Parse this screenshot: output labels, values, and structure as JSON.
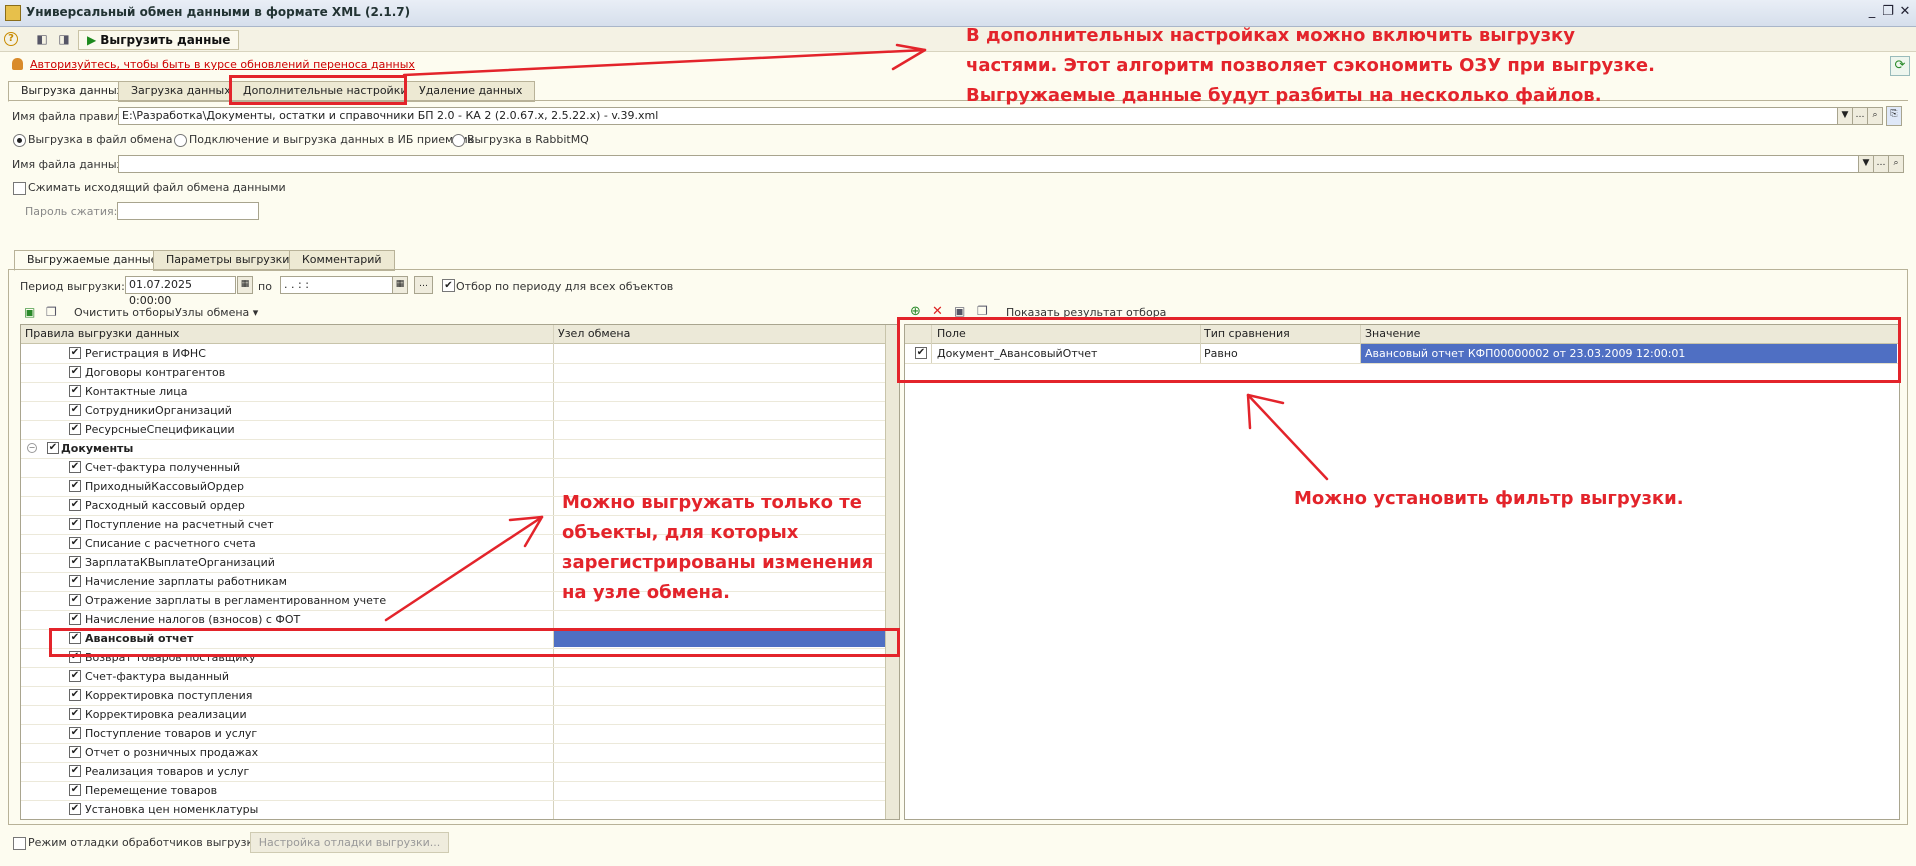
{
  "window": {
    "title": "Универсальный обмен данными в формате XML (2.1.7)"
  },
  "toolbar": {
    "export_label": "Выгрузить данные"
  },
  "auth_link": "Авторизуйтесь, чтобы быть в курсе обновлений переноса данных",
  "main_tabs": [
    "Выгрузка данных",
    "Загрузка данных",
    "Дополнительные настройки",
    "Удаление данных"
  ],
  "rules_file": {
    "label": "Имя файла правил:",
    "value": "E:\\Разработка\\Документы, остатки и справочники БП 2.0 - КА 2 (2.0.67.x, 2.5.22.x) - v.39.xml"
  },
  "export_modes": [
    "Выгрузка в файл обмена",
    "Подключение и выгрузка данных в ИБ приемник",
    "Выгрузка в RabbitMQ"
  ],
  "data_file": {
    "label": "Имя файла данных:",
    "value": ""
  },
  "compress": {
    "label": "Сжимать исходящий файл обмена данными"
  },
  "password": {
    "label": "Пароль сжатия:",
    "value": ""
  },
  "sub_tabs": [
    "Выгружаемые данные",
    "Параметры выгрузки",
    "Комментарий"
  ],
  "period": {
    "label": "Период выгрузки:",
    "from": "01.07.2025  0:00:00",
    "to_label": "по",
    "to": " .  .       :  :",
    "filter_all": "Отбор по периоду для всех объектов"
  },
  "rules_toolbar": {
    "clear": "Очистить отборы",
    "nodes": "Узлы обмена"
  },
  "rules_grid": {
    "headers": [
      "Правила выгрузки данных",
      "Узел обмена"
    ],
    "group_label": "Документы",
    "rows_top": [
      "Регистрация в ИФНС",
      "Договоры контрагентов",
      "Контактные лица",
      "СотрудникиОрганизаций",
      "РесурсныеСпецификации"
    ],
    "rows_docs": [
      "Счет-фактура полученный",
      "ПриходныйКассовыйОрдер",
      "Расходный кассовый ордер",
      "Поступление на расчетный счет",
      "Списание с расчетного счета",
      "ЗарплатаКВыплатеОрганизаций",
      "Начисление зарплаты работникам",
      "Отражение зарплаты в регламентированном учете",
      "Начисление налогов (взносов) с ФОТ"
    ],
    "selected_row": "Авансовый отчет",
    "rows_after": [
      "Возврат товаров поставщику",
      "Счет-фактура выданный",
      "Корректировка поступления",
      "Корректировка реализации",
      "Поступление товаров и услуг",
      "Отчет о розничных продажах",
      "Реализация товаров и услуг",
      "Перемещение товаров",
      "Установка цен номенклатуры"
    ]
  },
  "filter_toolbar": {
    "show_result": "Показать результат отбора"
  },
  "filter_grid": {
    "headers": [
      "Поле",
      "Тип сравнения",
      "Значение"
    ],
    "row": {
      "field": "Документ_АвансовыйОтчет",
      "compare": "Равно",
      "value": "Авансовый отчет КФП00000002 от 23.03.2009 12:00:01"
    }
  },
  "debug": {
    "label": "Режим отладки обработчиков выгрузки",
    "button": "Настройка отладки выгрузки..."
  },
  "annotations": {
    "top": [
      "В дополнительных настройках можно включить выгрузку",
      "частями. Этот алгоритм позволяет сэкономить ОЗУ при выгрузке.",
      "Выгружаемые данные будут разбиты на несколько файлов."
    ],
    "middle": [
      "Можно выгружать только те",
      "объекты, для которых",
      "зарегистрированы изменения",
      "на узле обмена."
    ],
    "right": "Можно установить фильтр выгрузки."
  },
  "colors": {
    "accent_red": "#e3242b",
    "selection_blue": "#4f6fc3"
  }
}
